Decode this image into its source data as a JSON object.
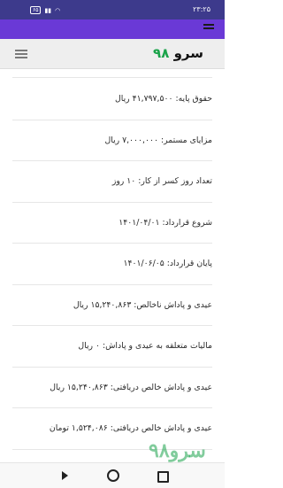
{
  "status_bar": {
    "battery": "۶۵",
    "time": "۲۳:۲۵"
  },
  "header": {
    "logo_text": "سرو",
    "logo_number": "۹۸"
  },
  "items": [
    {
      "label": "حقوق پایه: ۴۱,۷۹۷,۵۰۰ ریال"
    },
    {
      "label": "مزایای مستمر: ۷,۰۰۰,۰۰۰ ریال"
    },
    {
      "label": "تعداد روز کسر از کار: ۱۰ روز"
    },
    {
      "label": "شروع قرارداد: ۱۴۰۱/۰۴/۰۱"
    },
    {
      "label": "پایان قرارداد: ۱۴۰۱/۰۶/۰۵"
    },
    {
      "label": "عیدی و پاداش ناخالص: ۱۵,۲۴۰,۸۶۳ ریال"
    },
    {
      "label": "مالیات متعلقه به عیدی و پاداش: ۰ ریال"
    },
    {
      "label": "عیدی و پاداش خالص دریافتی: ۱۵,۲۴۰,۸۶۳ ریال"
    },
    {
      "label": "عیدی و پاداش خالص دریافتی: ۱,۵۲۴,۰۸۶ تومان"
    }
  ],
  "watermark": "سرو۹۸",
  "colors": {
    "status_bar": "#3d3a8c",
    "accent": "#6a39d6",
    "logo_green": "#1aa34a"
  }
}
